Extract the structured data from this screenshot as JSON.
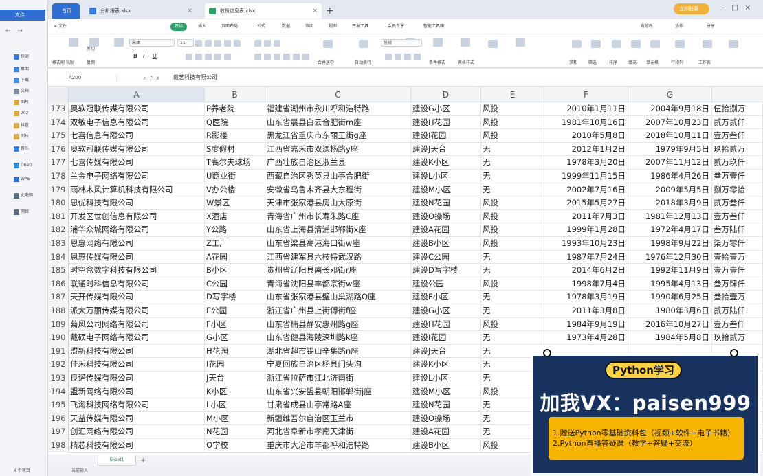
{
  "explorer": {
    "tab": "文件",
    "items": [
      "快速",
      "桌面",
      "下载",
      "文档",
      "图片",
      "202",
      "抖音",
      "图片",
      "音乐",
      "OneD",
      "WPS",
      "此电脑",
      "网络"
    ],
    "status": "4 个项目"
  },
  "titlebar": {
    "home_tab": "首页",
    "tabs": [
      "分析报表.xlsx",
      "收货信息表.xlsx"
    ],
    "vip_label": "立即登录"
  },
  "menu": {
    "file": "文件",
    "items": [
      "开始",
      "插入",
      "页面布局",
      "公式",
      "数据",
      "审阅",
      "视图",
      "开发工具",
      "会员专享",
      "智能工具箱"
    ],
    "active": "开始",
    "right": [
      "有修改",
      "协作",
      "分享"
    ]
  },
  "ribbon": {
    "labels": [
      "格式刷",
      "粘贴",
      "剪切",
      "复制",
      "宋体",
      "11",
      "B",
      "I",
      "U",
      "合并居中",
      "自动换行",
      "常规",
      "条件格式",
      "表格样式",
      "求和",
      "筛选",
      "排序",
      "填充",
      "单元格",
      "行和列",
      "工作表"
    ]
  },
  "formula_bar": {
    "cell_ref": "A200",
    "formula": "戴艺科技有限公司"
  },
  "columns": [
    "A",
    "B",
    "C",
    "D",
    "E",
    "F",
    "G"
  ],
  "rows": [
    {
      "n": "173",
      "a": "奥软冠联传媒有限公司",
      "b": "P养老院",
      "c": "福建省潮州市永川呼和浩特路",
      "d": "建设G小区",
      "e": "风投",
      "f": "2010年1月11日",
      "g": "2004年9月18日",
      "h": "伍拾捌万"
    },
    {
      "n": "174",
      "a": "双敏电子信息有限公司",
      "b": "Q医院",
      "c": "山东省晨县白云合肥街m座",
      "d": "建设H花园",
      "e": "风投",
      "f": "1981年10月16日",
      "g": "2007年10月23日",
      "h": "贰万贰仟"
    },
    {
      "n": "175",
      "a": "七喜信息有限公司",
      "b": "R影楼",
      "c": "黑龙江省重庆市东丽王街g座",
      "d": "建设I花园",
      "e": "风投",
      "f": "2010年5月8日",
      "g": "2018年10月11日",
      "h": "壹万叁仟"
    },
    {
      "n": "176",
      "a": "奥软冠联传媒有限公司",
      "b": "S度假村",
      "c": "江西省嘉禾市双滦杨路y座",
      "d": "建设J天台",
      "e": "无",
      "f": "2012年1月2日",
      "g": "1979年9月5日",
      "h": "玖拾贰万"
    },
    {
      "n": "177",
      "a": "七喜传媒有限公司",
      "b": "T高尔夫球场",
      "c": "广西壮族自治区淑兰县",
      "d": "建设K小区",
      "e": "无",
      "f": "1978年3月20日",
      "g": "2007年11月12日",
      "h": "贰万玖仟"
    },
    {
      "n": "178",
      "a": "兰金电子网络有限公司",
      "b": "U商业街",
      "c": "西藏自治区秀英县山亭合肥街",
      "d": "建设L小区",
      "e": "无",
      "f": "1999年11月15日",
      "g": "1986年4月26日",
      "h": "叁万壹仟"
    },
    {
      "n": "179",
      "a": "雨林木风计算机科技有限公司",
      "b": "V办公楼",
      "c": "安徽省乌鲁木齐县大东程街",
      "d": "建设M小区",
      "e": "无",
      "f": "2002年7月16日",
      "g": "2009年5月5日",
      "h": "捌万零拾"
    },
    {
      "n": "180",
      "a": "思优科技有限公司",
      "b": "W景区",
      "c": "天津市张家港县房山大原街",
      "d": "建设N花园",
      "e": "风投",
      "f": "2015年5月27日",
      "g": "2018年3月9日",
      "h": "贰万叁仟"
    },
    {
      "n": "181",
      "a": "开发区世创信息有限公司",
      "b": "X酒店",
      "c": "青海省广州市长寿朱路C座",
      "d": "建设O操场",
      "e": "风投",
      "f": "2011年7月3日",
      "g": "1981年12月13日",
      "h": "壹万叁仟"
    },
    {
      "n": "182",
      "a": "浦华众城网络有限公司",
      "b": "Y公路",
      "c": "山东省上海县清浦邯郸街x座",
      "d": "建设A花园",
      "e": "风投",
      "f": "1999年1月28日",
      "g": "1972年4月17日",
      "h": "叁万陆仟"
    },
    {
      "n": "183",
      "a": "恩惠网络有限公司",
      "b": "Z工厂",
      "c": "山东省梁县高港海口街w座",
      "d": "建设B小区",
      "e": "风投",
      "f": "1993年10月23日",
      "g": "1998年9月22日",
      "h": "柒万零仟"
    },
    {
      "n": "184",
      "a": "恩惠传媒有限公司",
      "b": "A花园",
      "c": "江西省建军县六枝特武汉路",
      "d": "建设C公园",
      "e": "无",
      "f": "1987年7月24日",
      "g": "1976年12月30日",
      "h": "壹拾壹万"
    },
    {
      "n": "185",
      "a": "时空盒数字科技有限公司",
      "b": "B小区",
      "c": "贵州省辽阳县南长邓街r座",
      "d": "建设D写字楼",
      "e": "无",
      "f": "2014年6月2日",
      "g": "1992年11月9日",
      "h": "壹万壹仟"
    },
    {
      "n": "186",
      "a": "联通时科信息有限公司",
      "b": "C公园",
      "c": "青海省沈阳县丰都宗街w座",
      "d": "建设公园",
      "e": "风投",
      "f": "1998年7月4日",
      "g": "1995年4月13日",
      "h": "叁万肆仟"
    },
    {
      "n": "187",
      "a": "天开传媒有限公司",
      "b": "D写字楼",
      "c": "山东省张家港县璧山巢湖路Q座",
      "d": "建设F小区",
      "e": "无",
      "f": "1978年3月19日",
      "g": "1990年6月25日",
      "h": "叁拾壹万"
    },
    {
      "n": "188",
      "a": "派大万丽传媒有限公司",
      "b": "E公园",
      "c": "浙江省广州县上街傅街f座",
      "d": "建设G小区",
      "e": "无",
      "f": "2011年3月8日",
      "g": "1980年3月6日",
      "h": "贰万陆仟"
    },
    {
      "n": "189",
      "a": "菊风公司网络有限公司",
      "b": "F小区",
      "c": "山东省楠县静安惠州路g座",
      "d": "建设H花园",
      "e": "风投",
      "f": "1984年9月19日",
      "g": "2016年10月27日",
      "h": "壹万叁仟"
    },
    {
      "n": "190",
      "a": "戴硕电子网络有限公司",
      "b": "G小区",
      "c": "山东省健县海陵深圳路k座",
      "d": "建设I花园",
      "e": "无",
      "f": "1973年4月28日",
      "g": "1984年5月8日",
      "h": "玖拾贰万"
    },
    {
      "n": "191",
      "a": "盟新科技有限公司",
      "b": "H花园",
      "c": "湖北省超市锡山辛集路n座",
      "d": "建设J天台",
      "e": "无",
      "f": "",
      "g": "",
      "h": ""
    },
    {
      "n": "192",
      "a": "佳禾科技有限公司",
      "b": "I花园",
      "c": "宁夏回族自治区杨县门头沟",
      "d": "建设K小区",
      "e": "无",
      "f": "",
      "g": "",
      "h": ""
    },
    {
      "n": "193",
      "a": "良诺传媒有限公司",
      "b": "J天台",
      "c": "浙江省拉萨市江北济南街",
      "d": "建设L小区",
      "e": "无",
      "f": "",
      "g": "",
      "h": ""
    },
    {
      "n": "194",
      "a": "盟新网络有限公司",
      "b": "K小区",
      "c": "山东省兴安盟县朝阳邯郸街j座",
      "d": "建设M小区",
      "e": "风投",
      "f": "",
      "g": "",
      "h": ""
    },
    {
      "n": "195",
      "a": "飞海科技网络有限公司",
      "b": "L小区",
      "c": "甘肃省成县山亭常路A座",
      "d": "建设N花园",
      "e": "无",
      "f": "",
      "g": "",
      "h": ""
    },
    {
      "n": "196",
      "a": "天益传媒有限公司",
      "b": "M小区",
      "c": "新疆维吾尔自治区玉兰市",
      "d": "建设O操场",
      "e": "无",
      "f": "",
      "g": "",
      "h": ""
    },
    {
      "n": "197",
      "a": "创汇网络有限公司",
      "b": "N花园",
      "c": "河北省阜新市孝南天津街",
      "d": "建设A花园",
      "e": "无",
      "f": "",
      "g": "",
      "h": ""
    },
    {
      "n": "198",
      "a": "精芯科技有限公司",
      "b": "O学校",
      "c": "重庆市大冶市丰都呼和浩特路",
      "d": "建设B小区",
      "e": "风投",
      "f": "",
      "g": "",
      "h": ""
    }
  ],
  "sheet": {
    "tab": "Sheet1",
    "add": "+",
    "status": "当前输入"
  },
  "promo": {
    "title": "Python学习",
    "contact": "加我VX：paisen999",
    "line1": "1.赠送Python零基础资料包（视频+软件+电子书籍）",
    "line2": "2.Python直播答疑课（教学+答疑+交流）"
  },
  "colors": {
    "accent_green": "#2aa36b",
    "wps_blue": "#2f6fd3",
    "promo_bg": "#17325f",
    "promo_yellow": "#ffd23f",
    "promo_box": "#f7b500"
  }
}
